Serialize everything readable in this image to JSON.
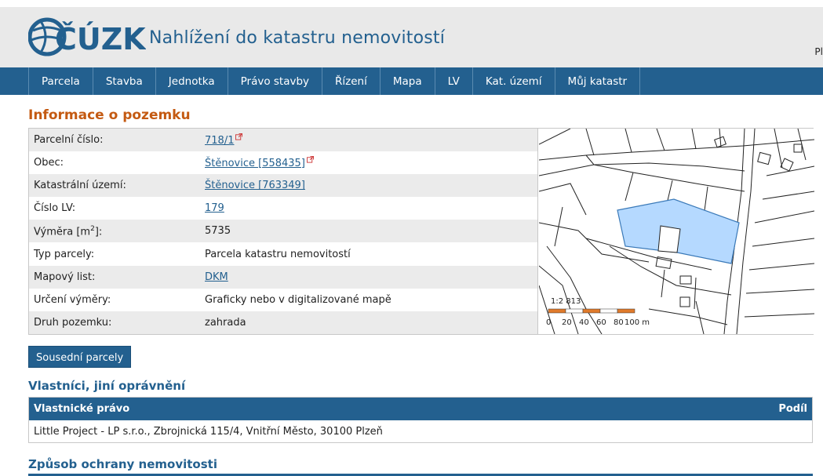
{
  "header": {
    "logo_text": "ČÚZK",
    "site_title": "Nahlížení do katastru nemovitostí",
    "right_text": "Pl"
  },
  "nav": {
    "items": [
      "Parcela",
      "Stavba",
      "Jednotka",
      "Právo stavby",
      "Řízení",
      "Mapa",
      "LV",
      "Kat. území",
      "Můj katastr"
    ]
  },
  "parcel": {
    "section_title": "Informace o pozemku",
    "rows": [
      {
        "label": "Parcelní číslo:",
        "value": "718/1"
      },
      {
        "label": "Obec:",
        "value": "Štěnovice [558435]"
      },
      {
        "label": "Katastrální území:",
        "value": "Štěnovice [763349]"
      },
      {
        "label": "Číslo LV:",
        "value": "179"
      },
      {
        "label": "Výměra [m",
        "label_sup": "2",
        "label_suffix": "]:",
        "value": "5735"
      },
      {
        "label": "Typ parcely:",
        "value": "Parcela katastru nemovitostí"
      },
      {
        "label": "Mapový list:",
        "value": "DKM"
      },
      {
        "label": "Určení výměry:",
        "value": "Graficky nebo v digitalizované mapě"
      },
      {
        "label": "Druh pozemku:",
        "value": "zahrada"
      }
    ]
  },
  "map": {
    "scale_ratio": "1:2 813",
    "scale_labels": [
      "0",
      "20",
      "40",
      "60",
      "80",
      "100 m"
    ],
    "highlight_color": "#b5d9ff"
  },
  "buttons": {
    "neighbors": "Sousední parcely"
  },
  "owners": {
    "title": "Vlastníci, jiní oprávnění",
    "col_right": "Vlastnické právo",
    "col_share": "Podíl",
    "rows": [
      {
        "name": "Little Project - LP s.r.o., Zbrojnická 115/4, Vnitřní Město, 30100 Plzeň"
      }
    ]
  },
  "protection": {
    "title": "Způsob ochrany nemovitosti"
  },
  "colors": {
    "primary": "#23608f",
    "accent": "#c45a12"
  }
}
